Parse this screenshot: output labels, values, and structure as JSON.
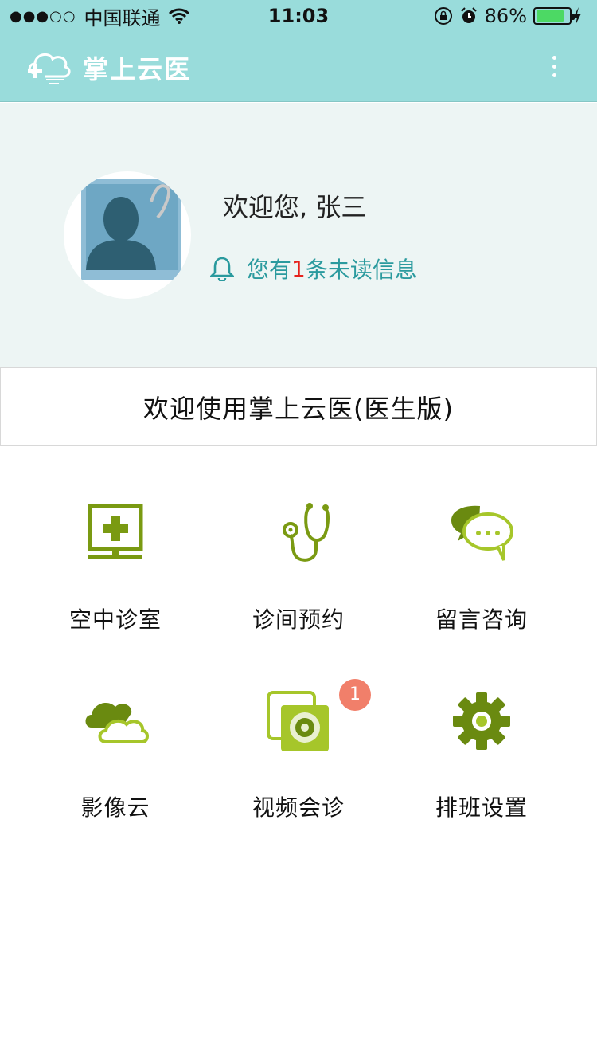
{
  "status_bar": {
    "signal": "●●●○○",
    "carrier": "中国联通",
    "time": "11:03",
    "battery_percent": "86%",
    "battery_level": 0.86
  },
  "header": {
    "title": "掌上云医",
    "menu_icon": "more-vertical-icon"
  },
  "profile": {
    "greeting": "欢迎您, 张三",
    "notice_prefix": "您有",
    "notice_count": "1",
    "notice_suffix": "条未读信息"
  },
  "welcome": "欢迎使用掌上云医(医生版)",
  "menu": [
    {
      "label": "空中诊室",
      "icon": "monitor-medical-icon"
    },
    {
      "label": "诊间预约",
      "icon": "stethoscope-icon"
    },
    {
      "label": "留言咨询",
      "icon": "chat-bubbles-icon"
    },
    {
      "label": "影像云",
      "icon": "cloud-icon"
    },
    {
      "label": "视频会诊",
      "icon": "camera-icon",
      "badge": "1"
    },
    {
      "label": "排班设置",
      "icon": "gear-icon"
    }
  ],
  "colors": {
    "header_bg": "#99dcdb",
    "profile_bg": "#edf5f4",
    "icon_green": "#7a9a12",
    "notice_teal": "#2a9a9e",
    "badge": "#f17f6a"
  }
}
